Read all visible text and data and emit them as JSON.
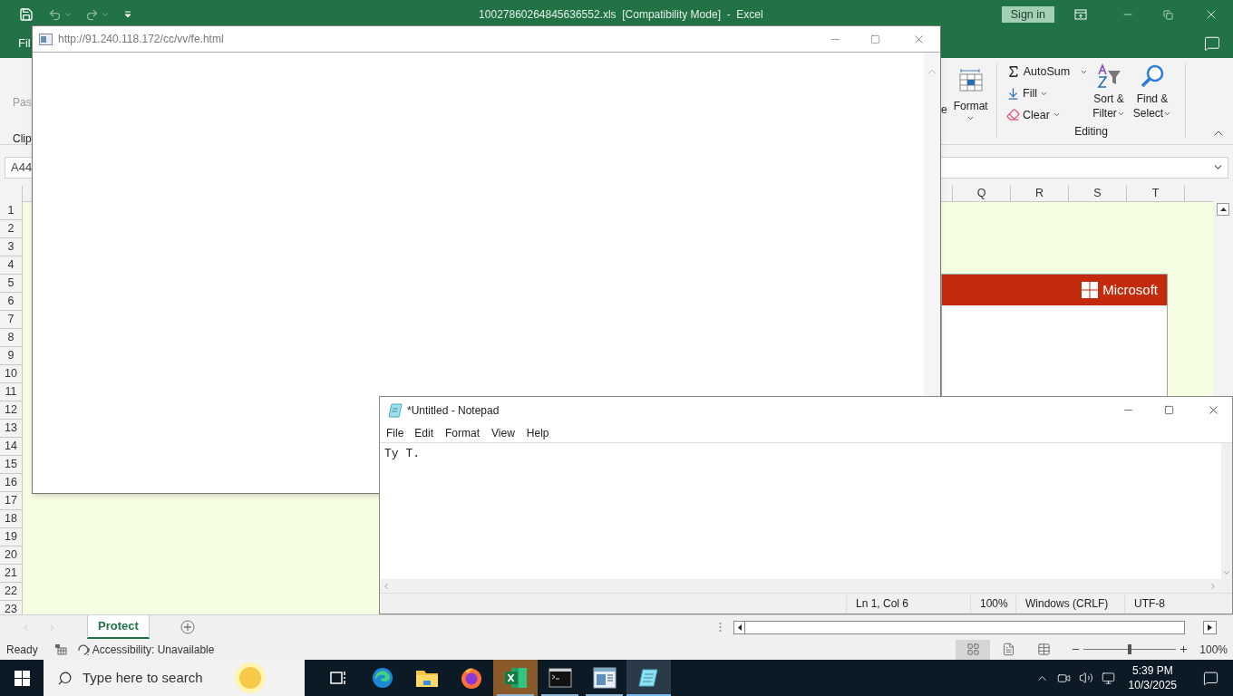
{
  "excel": {
    "title": "10027860264845636552.xls  [Compatibility Mode]  -  Excel",
    "sign_in": "Sign in",
    "tab_partial": "Fil",
    "ribbon": {
      "paste_partial": "Pas",
      "clipboard_partial": "Clip",
      "cells_partial": "e",
      "format": "Format",
      "autosum": "AutoSum",
      "fill": "Fill",
      "clear": "Clear",
      "sort_filter": [
        "Sort &",
        "Filter"
      ],
      "find_select": [
        "Find &",
        "Select"
      ],
      "editing_group": "Editing"
    },
    "name_box": "A44",
    "columns": [
      "Q",
      "R",
      "S",
      "T"
    ],
    "rows": [
      "1",
      "2",
      "3",
      "4",
      "5",
      "6",
      "7",
      "8",
      "9",
      "10",
      "11",
      "12",
      "13",
      "14",
      "15",
      "16",
      "17",
      "18",
      "19",
      "20",
      "21",
      "22",
      "23"
    ],
    "banner": {
      "brand": "Microsoft"
    },
    "sheet_tabs": [
      {
        "label": "Protect",
        "selected": true
      }
    ],
    "status": {
      "ready": "Ready",
      "accessibility": "Accessibility: Unavailable",
      "zoom": "100%"
    },
    "views": [
      {
        "kind": "normal",
        "selected": true
      },
      {
        "kind": "page-layout",
        "selected": false
      },
      {
        "kind": "page-break",
        "selected": false
      }
    ],
    "zoom_slider": {
      "level": 0.5
    }
  },
  "browser_popup": {
    "address": "http://91.240.118.172/cc/vv/fe.html"
  },
  "notepad": {
    "title": "*Untitled - Notepad",
    "menu": [
      "File",
      "Edit",
      "Format",
      "View",
      "Help"
    ],
    "text": "Ty T.",
    "status": [
      "Ln 1, Col 6",
      "100%",
      "Windows (CRLF)",
      "UTF-8"
    ]
  },
  "taskbar": {
    "search_placeholder": "Type here to search",
    "apps": [
      {
        "kind": "task-view",
        "running": false,
        "selected": false,
        "flashing": false
      },
      {
        "kind": "edge",
        "running": false,
        "selected": false,
        "flashing": false
      },
      {
        "kind": "explorer",
        "running": false,
        "selected": false,
        "flashing": false
      },
      {
        "kind": "firefox",
        "running": false,
        "selected": false,
        "flashing": false
      },
      {
        "kind": "excel",
        "running": true,
        "selected": false,
        "flashing": true
      },
      {
        "kind": "terminal",
        "running": true,
        "selected": false,
        "flashing": false
      },
      {
        "kind": "window",
        "running": true,
        "selected": false,
        "flashing": false
      },
      {
        "kind": "notepad",
        "running": true,
        "selected": true,
        "flashing": false
      }
    ],
    "time": "5:39 PM",
    "date": "10/3/2025"
  }
}
